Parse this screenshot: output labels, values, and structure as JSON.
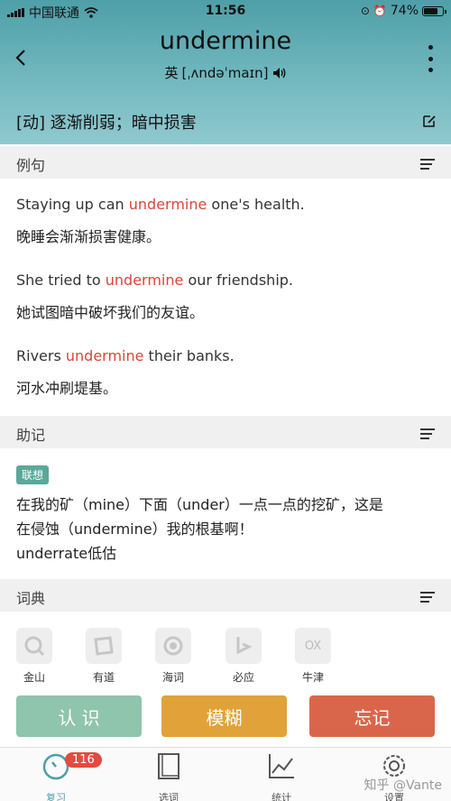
{
  "status": {
    "carrier": "中国联通",
    "time": "11:56",
    "battery": "74%"
  },
  "word": {
    "title": "undermine",
    "phonetic_region": "英",
    "phonetic": "[ˌʌndəˈmaɪn]",
    "definition": "[动] 逐渐削弱；暗中损害"
  },
  "examples": {
    "header": "例句",
    "items": [
      {
        "pre": "Staying up can ",
        "hl": "undermine",
        "post": " one's health.",
        "cn": "晚睡会渐渐损害健康。"
      },
      {
        "pre": "She tried to ",
        "hl": "undermine",
        "post": " our friendship.",
        "cn": "她试图暗中破坏我们的友谊。"
      },
      {
        "pre": "Rivers ",
        "hl": "undermine",
        "post": " their banks.",
        "cn": "河水冲刷堤基。"
      }
    ]
  },
  "mnemonic": {
    "header": "助记",
    "tag": "联想",
    "line1": "在我的矿（mine）下面（under）一点一点的挖矿，这是",
    "line2": "在侵蚀（undermine）我的根基啊！",
    "line3": "underrate低估"
  },
  "dictionary": {
    "header": "词典",
    "items": [
      {
        "label": "金山",
        "icon": "jinshan-icon"
      },
      {
        "label": "有道",
        "icon": "youdao-icon"
      },
      {
        "label": "海词",
        "icon": "haici-icon"
      },
      {
        "label": "必应",
        "icon": "bing-icon"
      },
      {
        "label": "牛津",
        "icon": "oxford-icon",
        "mark": "OX"
      }
    ]
  },
  "actions": [
    {
      "label": "认 识",
      "color": "#8fc4ad"
    },
    {
      "label": "模糊",
      "color": "#e1a23a"
    },
    {
      "label": "忘记",
      "color": "#d9664a"
    }
  ],
  "tabs": [
    {
      "label": "复习",
      "badge": "116"
    },
    {
      "label": "选词"
    },
    {
      "label": "统计"
    },
    {
      "label": "设置"
    }
  ],
  "watermark": "知乎 @Vante",
  "colors": {
    "highlight": "#d9453a",
    "accent": "#4e9fa8",
    "tag": "#5aa89a",
    "badge": "#e24b3f"
  }
}
